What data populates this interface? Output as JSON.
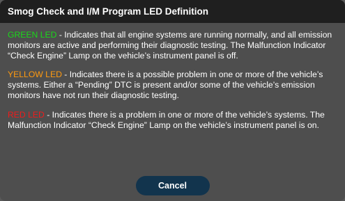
{
  "dialog": {
    "title": "Smog Check and I/M Program LED Definition",
    "paragraphs": {
      "green": {
        "label": "GREEN LED",
        "text": " - Indicates that all engine systems are running normally, and all emission monitors are active and performing their diagnostic testing. The Malfunction Indicator “Check Engine” Lamp on the vehicle’s instrument panel is off."
      },
      "yellow": {
        "label": "YELLOW LED",
        "text": " - Indicates there is a possible problem in one or more of the vehicle’s systems. Either a “Pending” DTC is present and/or some of the vehicle’s emission monitors have not run their diagnostic testing."
      },
      "red": {
        "label": "RED LED",
        "text": " - Indicates there is a problem in one or more of the vehicle’s systems. The Malfunction Indicator “Check Engine” Lamp on the vehicle’s instrument panel is on."
      }
    },
    "cancel_label": "Cancel"
  },
  "colors": {
    "green_led": "#1ad81a",
    "yellow_led": "#ff9a10",
    "red_led": "#ee1c1c",
    "title_bar": "#1f1f1f",
    "dialog_bg": "#4e4e4e",
    "cancel_button": "#12344d"
  }
}
